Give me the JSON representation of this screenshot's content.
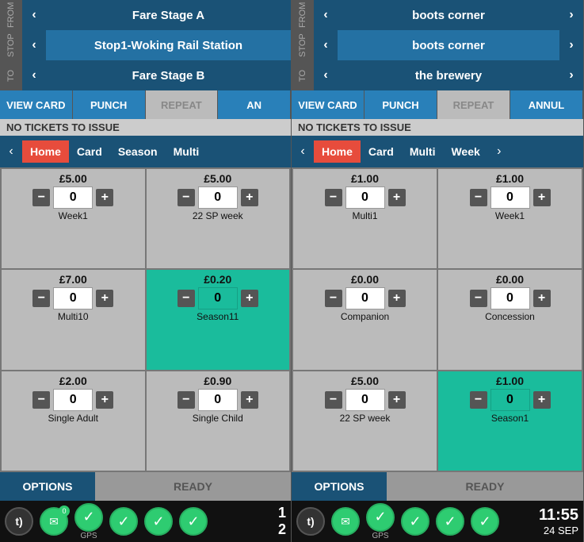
{
  "left_panel": {
    "from_label": "FROM",
    "stop_label": "STOP",
    "to_label": "TO",
    "rows": [
      {
        "text": "Fare Stage A",
        "selected": false
      },
      {
        "text": "Stop1-Woking Rail Station",
        "selected": true
      },
      {
        "text": "Fare Stage B",
        "selected": false
      }
    ],
    "actions": [
      {
        "label": "VIEW CARD",
        "state": "active"
      },
      {
        "label": "PUNCH",
        "state": "active"
      },
      {
        "label": "REPEAT",
        "state": "dim"
      },
      {
        "label": "AN",
        "state": "active"
      }
    ],
    "no_tickets": "NO TICKETS TO ISSUE",
    "tabs": [
      "Home",
      "Card",
      "Season",
      "Multi"
    ],
    "active_tab": "Home",
    "tickets": [
      {
        "price": "£5.00",
        "qty": "0",
        "label": "Week1",
        "highlight": false
      },
      {
        "price": "£5.00",
        "qty": "0",
        "label": "22 SP week",
        "highlight": false
      },
      {
        "price": "£7.00",
        "qty": "0",
        "label": "Multi10",
        "highlight": false
      },
      {
        "price": "£0.20",
        "qty": "0",
        "label": "Season11",
        "highlight": true
      },
      {
        "price": "£2.00",
        "qty": "0",
        "label": "Single Adult",
        "highlight": false
      },
      {
        "price": "£0.90",
        "qty": "0",
        "label": "Single Child",
        "highlight": false
      }
    ],
    "options_label": "OPTIONS",
    "ready_label": "READY"
  },
  "right_panel": {
    "from_label": "FROM",
    "stop_label": "STOP",
    "to_label": "TO",
    "rows": [
      {
        "text": "boots corner",
        "selected": false
      },
      {
        "text": "boots corner",
        "selected": true
      },
      {
        "text": "the brewery",
        "selected": false
      }
    ],
    "actions": [
      {
        "label": "VIEW CARD",
        "state": "active"
      },
      {
        "label": "PUNCH",
        "state": "active"
      },
      {
        "label": "REPEAT",
        "state": "dim"
      },
      {
        "label": "ANNUL",
        "state": "active"
      }
    ],
    "no_tickets": "NO TICKETS TO ISSUE",
    "tabs": [
      "Home",
      "Card",
      "Multi",
      "Week"
    ],
    "active_tab": "Home",
    "tickets": [
      {
        "price": "£1.00",
        "qty": "0",
        "label": "Multi1",
        "highlight": false
      },
      {
        "price": "£1.00",
        "qty": "0",
        "label": "Week1",
        "highlight": false
      },
      {
        "price": "£0.00",
        "qty": "0",
        "label": "Companion",
        "highlight": false
      },
      {
        "price": "£0.00",
        "qty": "0",
        "label": "Concession",
        "highlight": false
      },
      {
        "price": "£5.00",
        "qty": "0",
        "label": "22 SP week",
        "highlight": false
      },
      {
        "price": "£1.00",
        "qty": "0",
        "label": "Season1",
        "highlight": true
      }
    ],
    "options_label": "OPTIONS",
    "ready_label": "READY",
    "time": "11:55",
    "date": "24 SEP"
  },
  "left_status": {
    "icons": [
      "t",
      "✉",
      "GPS",
      "🌐",
      "📶",
      "🖨"
    ],
    "numbers": [
      "1",
      "2"
    ]
  },
  "right_status": {
    "icons": [
      "t",
      "✉",
      "GPS",
      "🌐",
      "📶",
      "🖨"
    ],
    "time": "11:55",
    "date": "24 SEP"
  }
}
